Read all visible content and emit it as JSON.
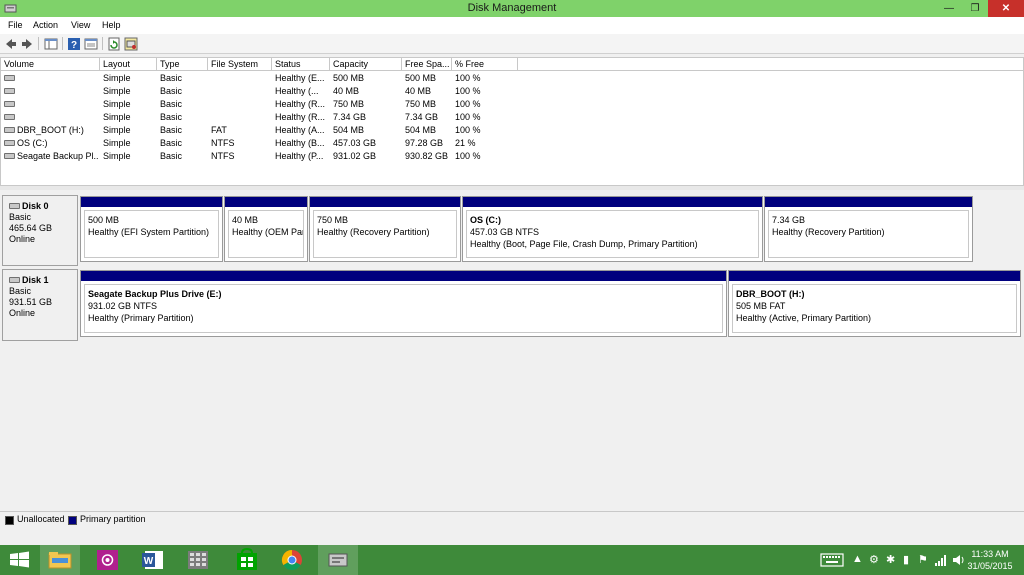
{
  "window": {
    "title": "Disk Management",
    "minimize": "—",
    "restore": "❐",
    "close": "✕"
  },
  "menu": [
    "File",
    "Action",
    "View",
    "Help"
  ],
  "table": {
    "headers": [
      "Volume",
      "Layout",
      "Type",
      "File System",
      "Status",
      "Capacity",
      "Free Spa...",
      "% Free"
    ],
    "rows": [
      [
        "",
        "Simple",
        "Basic",
        "",
        "Healthy (E...",
        "500 MB",
        "500 MB",
        "100 %"
      ],
      [
        "",
        "Simple",
        "Basic",
        "",
        "Healthy (...",
        "40 MB",
        "40 MB",
        "100 %"
      ],
      [
        "",
        "Simple",
        "Basic",
        "",
        "Healthy (R...",
        "750 MB",
        "750 MB",
        "100 %"
      ],
      [
        "",
        "Simple",
        "Basic",
        "",
        "Healthy (R...",
        "7.34 GB",
        "7.34 GB",
        "100 %"
      ],
      [
        "DBR_BOOT (H:)",
        "Simple",
        "Basic",
        "FAT",
        "Healthy (A...",
        "504 MB",
        "504 MB",
        "100 %"
      ],
      [
        "OS (C:)",
        "Simple",
        "Basic",
        "NTFS",
        "Healthy (B...",
        "457.03 GB",
        "97.28 GB",
        "21 %"
      ],
      [
        "Seagate Backup Pl...",
        "Simple",
        "Basic",
        "NTFS",
        "Healthy (P...",
        "931.02 GB",
        "930.82 GB",
        "100 %"
      ]
    ]
  },
  "disks": [
    {
      "name": "Disk 0",
      "type": "Basic",
      "size": "465.64 GB",
      "status": "Online",
      "partitions": [
        {
          "name": "",
          "size": "500 MB",
          "status": "Healthy (EFI System Partition)"
        },
        {
          "name": "",
          "size": "40 MB",
          "status": "Healthy (OEM Part"
        },
        {
          "name": "",
          "size": "750 MB",
          "status": "Healthy (Recovery Partition)"
        },
        {
          "name": "OS  (C:)",
          "size": "457.03 GB NTFS",
          "status": "Healthy (Boot, Page File, Crash Dump, Primary Partition)"
        },
        {
          "name": "",
          "size": "7.34 GB",
          "status": "Healthy (Recovery Partition)"
        }
      ]
    },
    {
      "name": "Disk 1",
      "type": "Basic",
      "size": "931.51 GB",
      "status": "Online",
      "partitions": [
        {
          "name": "Seagate Backup Plus Drive  (E:)",
          "size": "931.02 GB NTFS",
          "status": "Healthy (Primary Partition)"
        },
        {
          "name": "DBR_BOOT  (H:)",
          "size": "505 MB FAT",
          "status": "Healthy (Active, Primary Partition)"
        }
      ]
    }
  ],
  "legend": [
    {
      "label": "Unallocated",
      "color": "#000000"
    },
    {
      "label": "Primary partition",
      "color": "#00007e"
    }
  ],
  "taskbar": {
    "apps": [
      "start-icon",
      "file-explorer-icon",
      "camera-app-icon",
      "word-icon",
      "calculator-icon",
      "store-icon",
      "chrome-icon",
      "disk-management-icon"
    ],
    "clock_time": "11:33 AM",
    "clock_date": "31/05/2015"
  }
}
